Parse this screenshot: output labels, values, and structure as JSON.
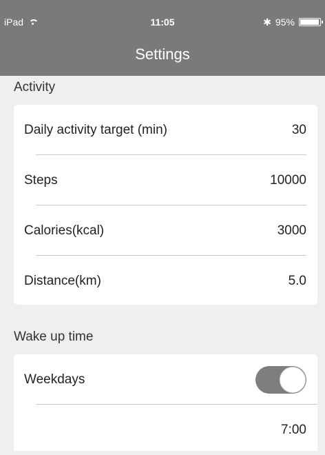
{
  "status": {
    "device": "iPad",
    "time": "11:05",
    "battery": "95%",
    "battery_level": 0.95
  },
  "nav": {
    "title": "Settings"
  },
  "activity": {
    "section_title": "Activity",
    "rows": [
      {
        "label": "Daily activity target (min)",
        "value": "30"
      },
      {
        "label": "Steps",
        "value": "10000"
      },
      {
        "label": "Calories(kcal)",
        "value": "3000"
      },
      {
        "label": "Distance(km)",
        "value": "5.0"
      }
    ]
  },
  "wake": {
    "section_title": "Wake up time",
    "weekdays_label": "Weekdays",
    "weekdays_on": true,
    "weekdays_time": "7:00"
  },
  "icons": {
    "wifi": "wifi-icon",
    "bluetooth": "bluetooth-icon",
    "battery": "battery-icon"
  }
}
